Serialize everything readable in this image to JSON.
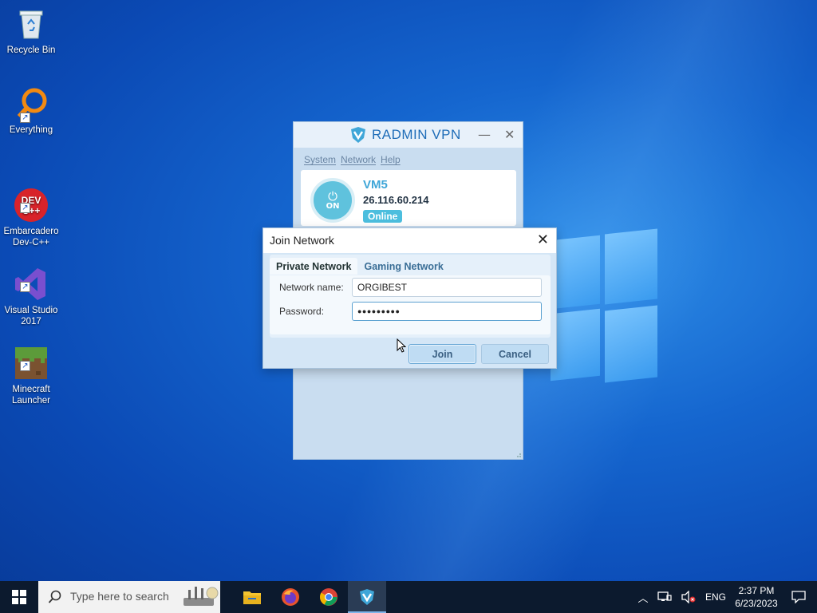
{
  "desktop": {
    "icons": [
      {
        "label": "Recycle Bin"
      },
      {
        "label": "Everything"
      },
      {
        "label": "Embarcadero\nDev-C++"
      },
      {
        "label": "Visual Studio\n2017"
      },
      {
        "label": "Minecraft\nLauncher"
      }
    ]
  },
  "radmin": {
    "logo_text": "RADMIN VPN",
    "menu": [
      "System",
      "Network",
      "Help"
    ],
    "power_label": "ON",
    "vm_name": "VM5",
    "vm_ip": "26.116.60.214",
    "vm_status": "Online"
  },
  "join_dialog": {
    "title": "Join Network",
    "tabs": [
      {
        "label": "Private Network",
        "active": true
      },
      {
        "label": "Gaming Network",
        "active": false
      }
    ],
    "network_name_label": "Network name:",
    "network_name_value": "ORGIBEST",
    "password_label": "Password:",
    "password_value": "●●●●●●●●●",
    "join_label": "Join",
    "cancel_label": "Cancel"
  },
  "taskbar": {
    "search_placeholder": "Type here to search",
    "language": "ENG",
    "time": "2:37 PM",
    "date": "6/23/2023"
  },
  "colors": {
    "radmin_accent": "#3fa6d8",
    "online_badge": "#4cbede",
    "taskbar_bg": "#0c1a2e"
  }
}
